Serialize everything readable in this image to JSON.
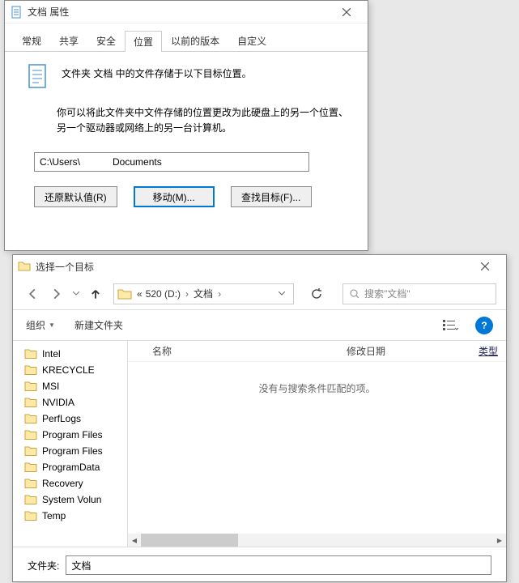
{
  "prop": {
    "title": "文档 属性",
    "tabs": [
      "常规",
      "共享",
      "安全",
      "位置",
      "以前的版本",
      "自定义"
    ],
    "active_tab": 3,
    "header_text": "文件夹 文档 中的文件存储于以下目标位置。",
    "info_text": "你可以将此文件夹中文件存储的位置更改为此硬盘上的另一个位置、另一个驱动器或网络上的另一台计算机。",
    "path_value": "C:\\Users\\            Documents",
    "btn_restore": "还原默认值(R)",
    "btn_move": "移动(M)...",
    "btn_find": "查找目标(F)..."
  },
  "browse": {
    "title": "选择一个目标",
    "crumb_prefix": "«",
    "crumb_drive": "520 (D:)",
    "crumb_folder": "文档",
    "search_placeholder": "搜索\"文档\"",
    "tool_organize": "组织",
    "tool_newfolder": "新建文件夹",
    "tree_items": [
      "Intel",
      "KRECYCLE",
      "MSI",
      "NVIDIA",
      "PerfLogs",
      "Program Files",
      "Program Files",
      "ProgramData",
      "Recovery",
      "System Volun",
      "Temp"
    ],
    "col_name": "名称",
    "col_date": "修改日期",
    "col_type": "类型",
    "empty_msg": "没有与搜索条件匹配的项。",
    "footer_label": "文件夹:",
    "footer_value": "文档"
  }
}
